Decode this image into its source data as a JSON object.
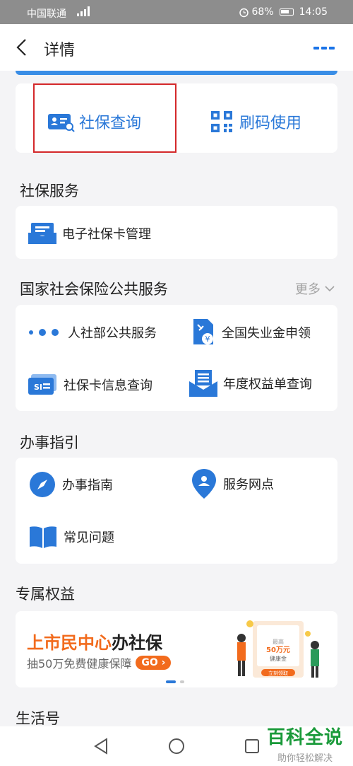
{
  "status_bar": {
    "carrier": "中国联通",
    "battery": "68%",
    "time": "14:05"
  },
  "header": {
    "title": "详情"
  },
  "quick_actions": [
    {
      "label": "社保查询"
    },
    {
      "label": "刷码使用"
    }
  ],
  "sections": {
    "social_security": {
      "title": "社保服务",
      "items": [
        {
          "label": "电子社保卡管理"
        }
      ]
    },
    "national": {
      "title": "国家社会保险公共服务",
      "more": "更多",
      "items": [
        {
          "label": "人社部公共服务"
        },
        {
          "label": "全国失业金申领"
        },
        {
          "label": "社保卡信息查询"
        },
        {
          "label": "年度权益单查询"
        }
      ]
    },
    "guide": {
      "title": "办事指引",
      "items": [
        {
          "label": "办事指南"
        },
        {
          "label": "服务网点"
        },
        {
          "label": "常见问题"
        }
      ]
    },
    "benefits": {
      "title": "专属权益",
      "banner": {
        "title_orange": "上市民中心",
        "title_dark": "办社保",
        "subtitle": "抽50万免费健康保障",
        "go": "GO",
        "card_small": "最高",
        "card_amount": "50万元",
        "card_label": "健康金",
        "card_button": "立刻领取"
      }
    },
    "life": {
      "title": "生活号"
    }
  },
  "watermark": {
    "line1": "百科全说",
    "line2": "助你轻松解决"
  },
  "colors": {
    "accent": "#2a78d8",
    "orange": "#f26b1d",
    "highlight": "#d4282a"
  }
}
